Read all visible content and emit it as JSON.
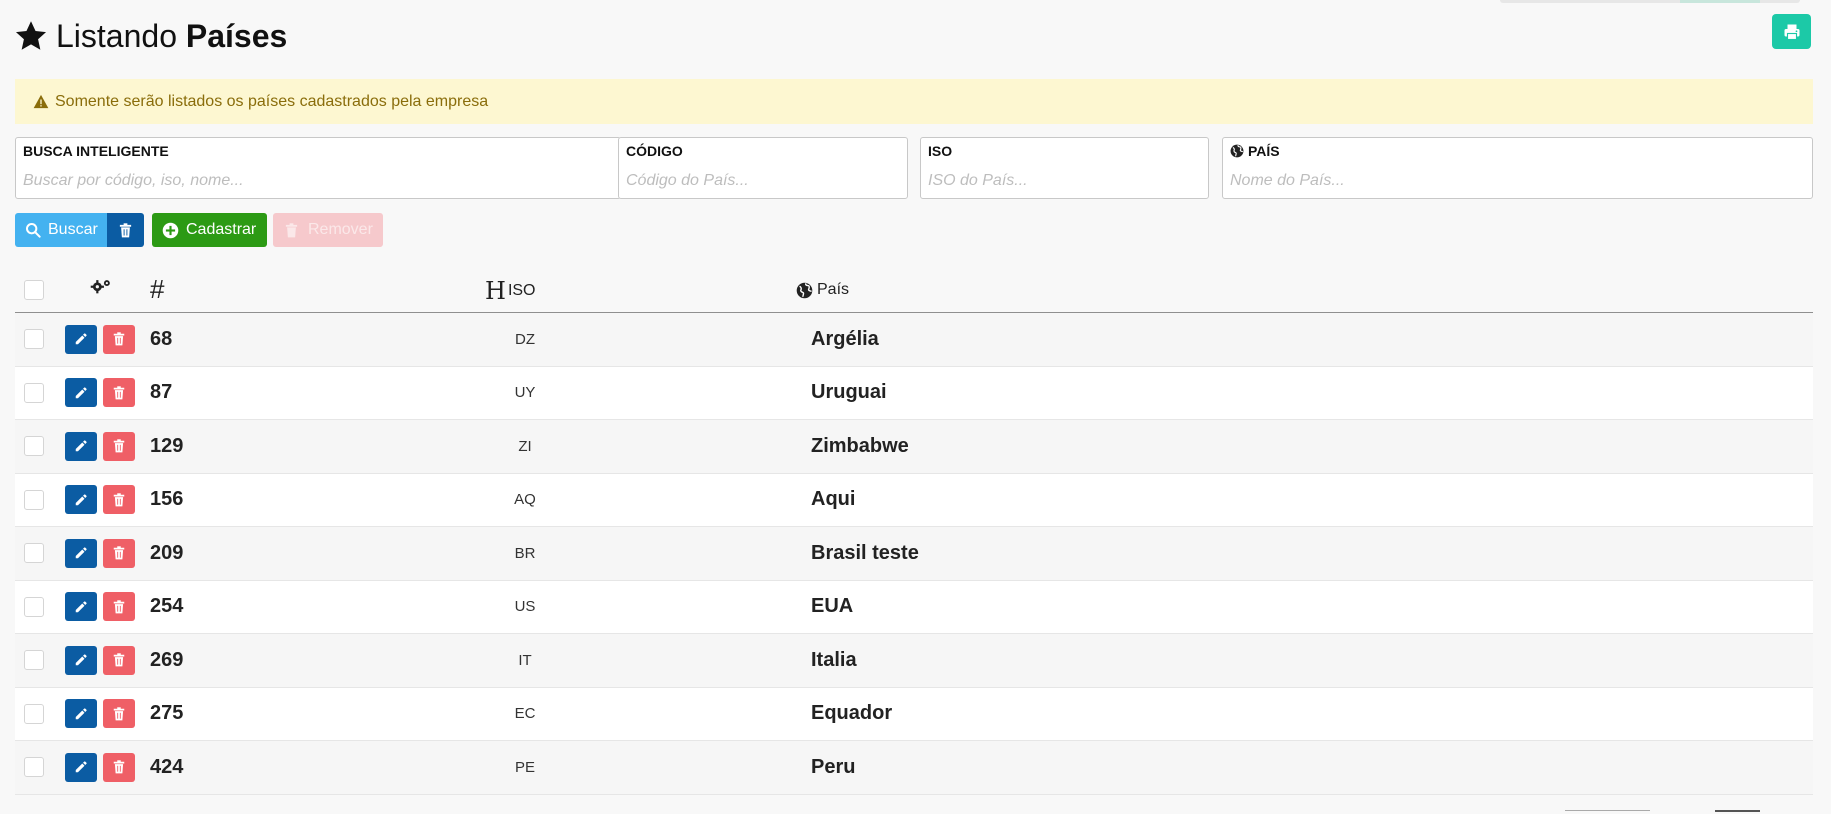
{
  "header": {
    "title_prefix": "Listando",
    "title_bold": "Países",
    "title_icon": "star-icon",
    "print_icon": "print-icon"
  },
  "alert": {
    "icon": "warning-icon",
    "text": "Somente serão listados os países cadastrados pela empresa"
  },
  "filters": {
    "smart_search": {
      "label": "BUSCA INTELIGENTE",
      "placeholder": "Buscar por código, iso, nome...",
      "value": ""
    },
    "code": {
      "label": "CÓDIGO",
      "placeholder": "Código do País...",
      "value": ""
    },
    "iso": {
      "label": "ISO",
      "placeholder": "ISO do País...",
      "value": ""
    },
    "country": {
      "label": "PAÍS",
      "placeholder": "Nome do País...",
      "value": "",
      "icon": "globe-icon"
    }
  },
  "toolbar": {
    "search_label": "Buscar",
    "add_label": "Cadastrar",
    "remove_label": "Remover"
  },
  "table": {
    "columns": {
      "id": "#",
      "iso": "ISO",
      "country": "País"
    },
    "rows": [
      {
        "id": "68",
        "iso": "DZ",
        "name": "Argélia"
      },
      {
        "id": "87",
        "iso": "UY",
        "name": "Uruguai"
      },
      {
        "id": "129",
        "iso": "ZI",
        "name": "Zimbabwe"
      },
      {
        "id": "156",
        "iso": "AQ",
        "name": "Aqui"
      },
      {
        "id": "209",
        "iso": "BR",
        "name": "Brasil teste"
      },
      {
        "id": "254",
        "iso": "US",
        "name": "EUA"
      },
      {
        "id": "269",
        "iso": "IT",
        "name": "Italia"
      },
      {
        "id": "275",
        "iso": "EC",
        "name": "Equador"
      },
      {
        "id": "424",
        "iso": "PE",
        "name": "Peru"
      }
    ]
  },
  "colors": {
    "primary": "#0b5ca3",
    "info": "#44b2f0",
    "success": "#2c9a14",
    "danger": "#ef5f66",
    "teal": "#1cc9a7",
    "warning_bg": "#fdf7d1"
  }
}
